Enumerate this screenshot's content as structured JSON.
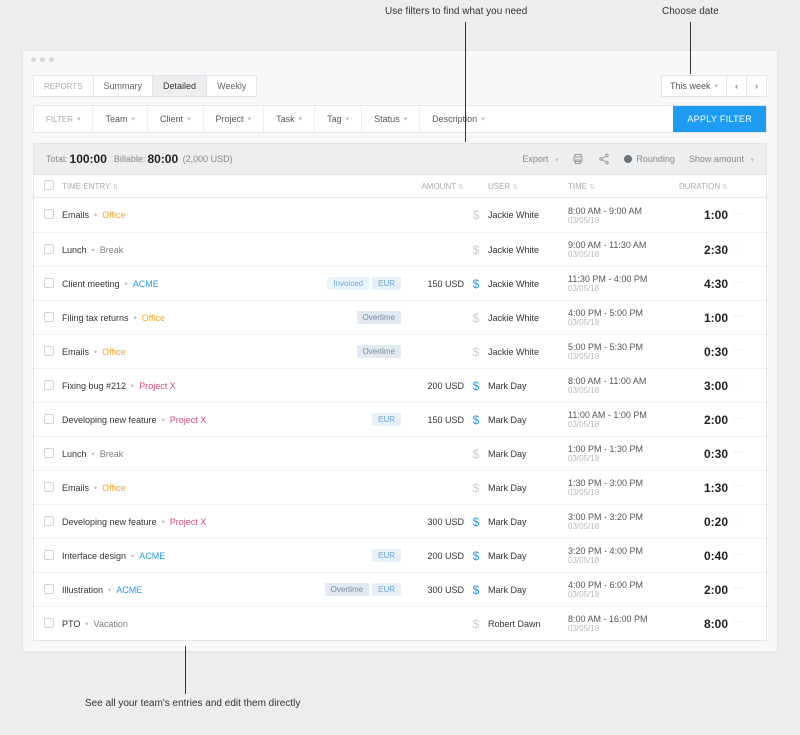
{
  "callouts": {
    "filters": "Use filters to find what you need",
    "date": "Choose date",
    "rows": "See all your team's entries and edit them directly"
  },
  "tabs": {
    "report": "REPORTS",
    "summary": "Summary",
    "detailed": "Detailed",
    "weekly": "Weekly"
  },
  "date_range": "This week",
  "filters": {
    "label": "FILTER",
    "items": [
      "Team",
      "Client",
      "Project",
      "Task",
      "Tag",
      "Status",
      "Description"
    ],
    "apply": "APPLY FILTER"
  },
  "summary": {
    "total_label": "Total:",
    "total": "100:00",
    "billable_label": "Billable:",
    "billable": "80:00",
    "billable_amount": "(2,000 USD)",
    "export": "Export",
    "rounding": "Rounding",
    "show_amount": "Show amount"
  },
  "columns": {
    "entry": "TIME ENTRY",
    "amount": "AMOUNT",
    "user": "USER",
    "time": "TIME",
    "duration": "DURATION"
  },
  "projects": {
    "office": "Office",
    "break": "Break",
    "acme": "ACME",
    "projectx": "Project X",
    "vacation": "Vacation"
  },
  "badges": {
    "invoiced": "Invoiced",
    "eur": "EUR",
    "overtime": "Overtime"
  },
  "rows": [
    {
      "desc": "Emails",
      "proj": "office",
      "badges": [],
      "amount": "",
      "billable": false,
      "user": "Jackie White",
      "time": "8:00 AM - 9:00 AM",
      "date": "03/05/18",
      "dur": "1:00"
    },
    {
      "desc": "Lunch",
      "proj": "break",
      "badges": [],
      "amount": "",
      "billable": false,
      "user": "Jackie White",
      "time": "9:00 AM - 11:30 AM",
      "date": "03/05/18",
      "dur": "2:30"
    },
    {
      "desc": "Client meeting",
      "proj": "acme",
      "badges": [
        "invoiced",
        "eur"
      ],
      "amount": "150 USD",
      "billable": true,
      "user": "Jackie White",
      "time": "11:30 PM - 4:00 PM",
      "date": "03/05/18",
      "dur": "4:30"
    },
    {
      "desc": "Filing tax returns",
      "proj": "office",
      "badges": [
        "overtime"
      ],
      "amount": "",
      "billable": false,
      "user": "Jackie White",
      "time": "4:00 PM - 5:00 PM",
      "date": "03/05/18",
      "dur": "1:00"
    },
    {
      "desc": "Emails",
      "proj": "office",
      "badges": [
        "overtime"
      ],
      "amount": "",
      "billable": false,
      "user": "Jackie White",
      "time": "5:00 PM - 5:30 PM",
      "date": "03/05/18",
      "dur": "0:30"
    },
    {
      "desc": "Fixing bug #212",
      "proj": "projectx",
      "badges": [],
      "amount": "200 USD",
      "billable": true,
      "user": "Mark Day",
      "time": "8:00 AM - 11:00 AM",
      "date": "03/05/18",
      "dur": "3:00"
    },
    {
      "desc": "Developing new feature",
      "proj": "projectx",
      "badges": [
        "eur"
      ],
      "amount": "150 USD",
      "billable": true,
      "user": "Mark Day",
      "time": "11:00 AM - 1:00 PM",
      "date": "03/05/18",
      "dur": "2:00"
    },
    {
      "desc": "Lunch",
      "proj": "break",
      "badges": [],
      "amount": "",
      "billable": false,
      "user": "Mark Day",
      "time": "1:00 PM - 1:30 PM",
      "date": "03/05/18",
      "dur": "0:30"
    },
    {
      "desc": "Emails",
      "proj": "office",
      "badges": [],
      "amount": "",
      "billable": false,
      "user": "Mark Day",
      "time": "1:30 PM - 3:00 PM",
      "date": "03/05/18",
      "dur": "1:30"
    },
    {
      "desc": "Developing new feature",
      "proj": "projectx",
      "badges": [],
      "amount": "300 USD",
      "billable": true,
      "user": "Mark Day",
      "time": "3:00 PM - 3:20 PM",
      "date": "03/05/18",
      "dur": "0:20"
    },
    {
      "desc": "Interface design",
      "proj": "acme",
      "badges": [
        "eur"
      ],
      "amount": "200 USD",
      "billable": true,
      "user": "Mark Day",
      "time": "3:20 PM - 4:00 PM",
      "date": "03/05/18",
      "dur": "0:40"
    },
    {
      "desc": "Illustration",
      "proj": "acme",
      "badges": [
        "overtime",
        "eur"
      ],
      "amount": "300 USD",
      "billable": true,
      "user": "Mark Day",
      "time": "4:00 PM - 6:00 PM",
      "date": "03/05/18",
      "dur": "2:00"
    },
    {
      "desc": "PTO",
      "proj": "vacation",
      "badges": [],
      "amount": "",
      "billable": false,
      "user": "Robert Dawn",
      "time": "8:00 AM - 16:00 PM",
      "date": "03/05/18",
      "dur": "8:00"
    }
  ]
}
